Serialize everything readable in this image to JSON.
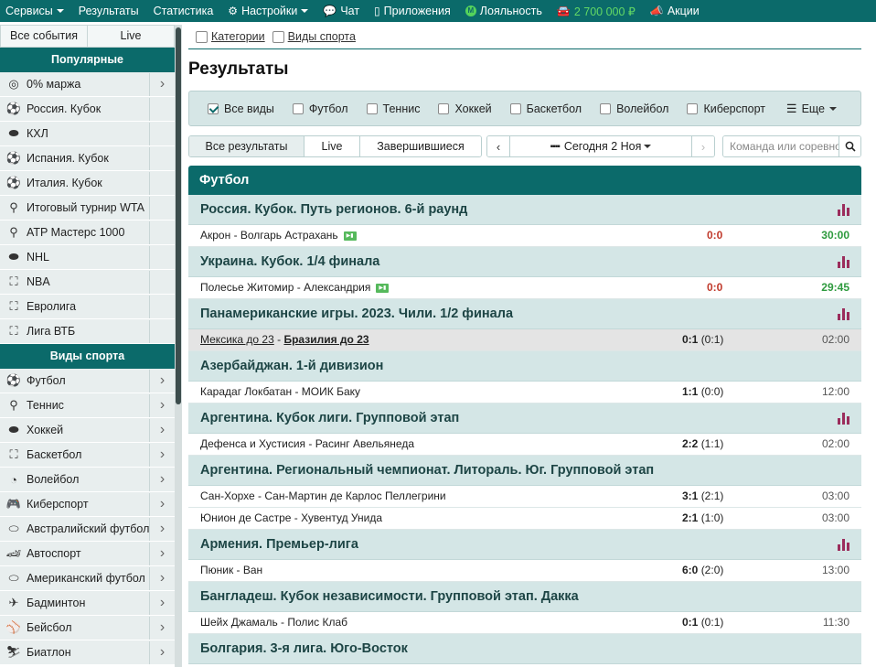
{
  "topnav": {
    "items": [
      {
        "label": "Сервисы",
        "has_caret": true
      },
      {
        "label": "Результаты"
      },
      {
        "label": "Статистика"
      },
      {
        "label": "Настройки",
        "icon": "gear-icon",
        "has_caret": true
      },
      {
        "label": "Чат",
        "icon": "chat-icon"
      },
      {
        "label": "Приложения",
        "icon": "phone-icon"
      },
      {
        "label": "Лояльность",
        "icon": "loyalty-icon"
      },
      {
        "label": "2 700 000 ₽",
        "icon": "car-icon"
      },
      {
        "label": "Акции",
        "icon": "megaphone-icon"
      }
    ]
  },
  "sidebar": {
    "tabs": [
      "Все события",
      "Live"
    ],
    "popular_title": "Популярные",
    "popular": [
      {
        "label": "0% маржа",
        "icon": "margin-icon",
        "arrow": true
      },
      {
        "label": "Россия. Кубок",
        "icon": "soccer-ball-icon"
      },
      {
        "label": "КХЛ",
        "icon": "hockey-puck-icon"
      },
      {
        "label": "Испания. Кубок",
        "icon": "soccer-ball-icon"
      },
      {
        "label": "Италия. Кубок",
        "icon": "soccer-ball-icon"
      },
      {
        "label": "Итоговый турнир WTA",
        "icon": "tennis-racket-icon"
      },
      {
        "label": "ATP Мастерс 1000",
        "icon": "tennis-racket-icon"
      },
      {
        "label": "NHL",
        "icon": "hockey-puck-icon"
      },
      {
        "label": "NBA",
        "icon": "basketball-icon"
      },
      {
        "label": "Евролига",
        "icon": "basketball-icon"
      },
      {
        "label": "Лига ВТБ",
        "icon": "basketball-icon"
      }
    ],
    "sports_title": "Виды спорта",
    "sports": [
      {
        "label": "Футбол",
        "icon": "soccer-ball-icon"
      },
      {
        "label": "Теннис",
        "icon": "tennis-racket-icon"
      },
      {
        "label": "Хоккей",
        "icon": "hockey-puck-icon"
      },
      {
        "label": "Баскетбол",
        "icon": "basketball-icon"
      },
      {
        "label": "Волейбол",
        "icon": "volleyball-icon"
      },
      {
        "label": "Киберспорт",
        "icon": "gamepad-icon"
      },
      {
        "label": "Австралийский футбол",
        "icon": "rugby-ball-icon"
      },
      {
        "label": "Автоспорт",
        "icon": "race-car-icon"
      },
      {
        "label": "Американский футбол",
        "icon": "rugby-ball-icon"
      },
      {
        "label": "Бадминтон",
        "icon": "shuttlecock-icon"
      },
      {
        "label": "Бейсбол",
        "icon": "baseball-icon"
      },
      {
        "label": "Биатлон",
        "icon": "biathlon-icon"
      }
    ]
  },
  "crumbs": [
    "Категории",
    "Виды спорта"
  ],
  "page_title": "Результаты",
  "filters": {
    "items": [
      {
        "label": "Все виды",
        "checked": true
      },
      {
        "label": "Футбол",
        "checked": false
      },
      {
        "label": "Теннис",
        "checked": false
      },
      {
        "label": "Хоккей",
        "checked": false
      },
      {
        "label": "Баскетбол",
        "checked": false
      },
      {
        "label": "Волейбол",
        "checked": false
      },
      {
        "label": "Киберспорт",
        "checked": false
      }
    ],
    "more_label": "Еще"
  },
  "controls": {
    "segments": [
      "Все результаты",
      "Live",
      "Завершившиеся"
    ],
    "active_segment": "Все результаты",
    "date_label": "Сегодня 2 Ноя",
    "search_placeholder": "Команда или соревнование"
  },
  "sport_title": "Футбол",
  "tournaments": [
    {
      "name": "Россия. Кубок. Путь регионов. 6-й раунд",
      "stats": true,
      "matches": [
        {
          "teams": "Акрон - Волгарь Астрахань",
          "live": true,
          "score": "0:0",
          "time": "30:00"
        }
      ]
    },
    {
      "name": "Украина. Кубок. 1/4 финала",
      "stats": true,
      "matches": [
        {
          "teams": "Полесье Житомир - Александрия",
          "live": true,
          "score": "0:0",
          "time": "29:45"
        }
      ]
    },
    {
      "name": "Панамериканские игры. 2023. Чили. 1/2 финала",
      "stats": true,
      "matches": [
        {
          "team_a": "Мексика до 23",
          "team_b": "Бразилия до 23",
          "score": "0:1",
          "half": "(0:1)",
          "time": "02:00",
          "highlight": true
        }
      ]
    },
    {
      "name": "Азербайджан. 1-й дивизион",
      "stats": false,
      "matches": [
        {
          "teams": "Карадаг Локбатан - МОИК Баку",
          "score": "1:1",
          "half": "(0:0)",
          "time": "12:00"
        }
      ]
    },
    {
      "name": "Аргентина. Кубок лиги. Групповой этап",
      "stats": true,
      "matches": [
        {
          "teams": "Дефенса и Хустисия - Расинг Авельянеда",
          "score": "2:2",
          "half": "(1:1)",
          "time": "02:00"
        }
      ]
    },
    {
      "name": "Аргентина. Региональный чемпионат. Литораль. Юг. Групповой этап",
      "stats": false,
      "matches": [
        {
          "teams": "Сан-Хорхе - Сан-Мартин де Карлос Пеллегрини",
          "score": "3:1",
          "half": "(2:1)",
          "time": "03:00"
        },
        {
          "teams": "Юнион де Састре - Хувентуд Унида",
          "score": "2:1",
          "half": "(1:0)",
          "time": "03:00"
        }
      ]
    },
    {
      "name": "Армения. Премьер-лига",
      "stats": true,
      "matches": [
        {
          "teams": "Пюник - Ван",
          "score": "6:0",
          "half": "(2:0)",
          "time": "13:00"
        }
      ]
    },
    {
      "name": "Бангладеш. Кубок независимости. Групповой этап. Дакка",
      "stats": false,
      "matches": [
        {
          "teams": "Шейх Джамаль - Полис Клаб",
          "score": "0:1",
          "half": "(0:1)",
          "time": "11:30"
        }
      ]
    },
    {
      "name": "Болгария. 3-я лига. Юго-Восток",
      "stats": false,
      "matches": []
    }
  ],
  "colors": {
    "brand": "#0b6a6a",
    "tournament_bg": "#d4e6e6",
    "live_score": "#c0392b",
    "live_time": "#2e9a3e",
    "stats_icon": "#9b2d5c",
    "money": "#63d965"
  }
}
